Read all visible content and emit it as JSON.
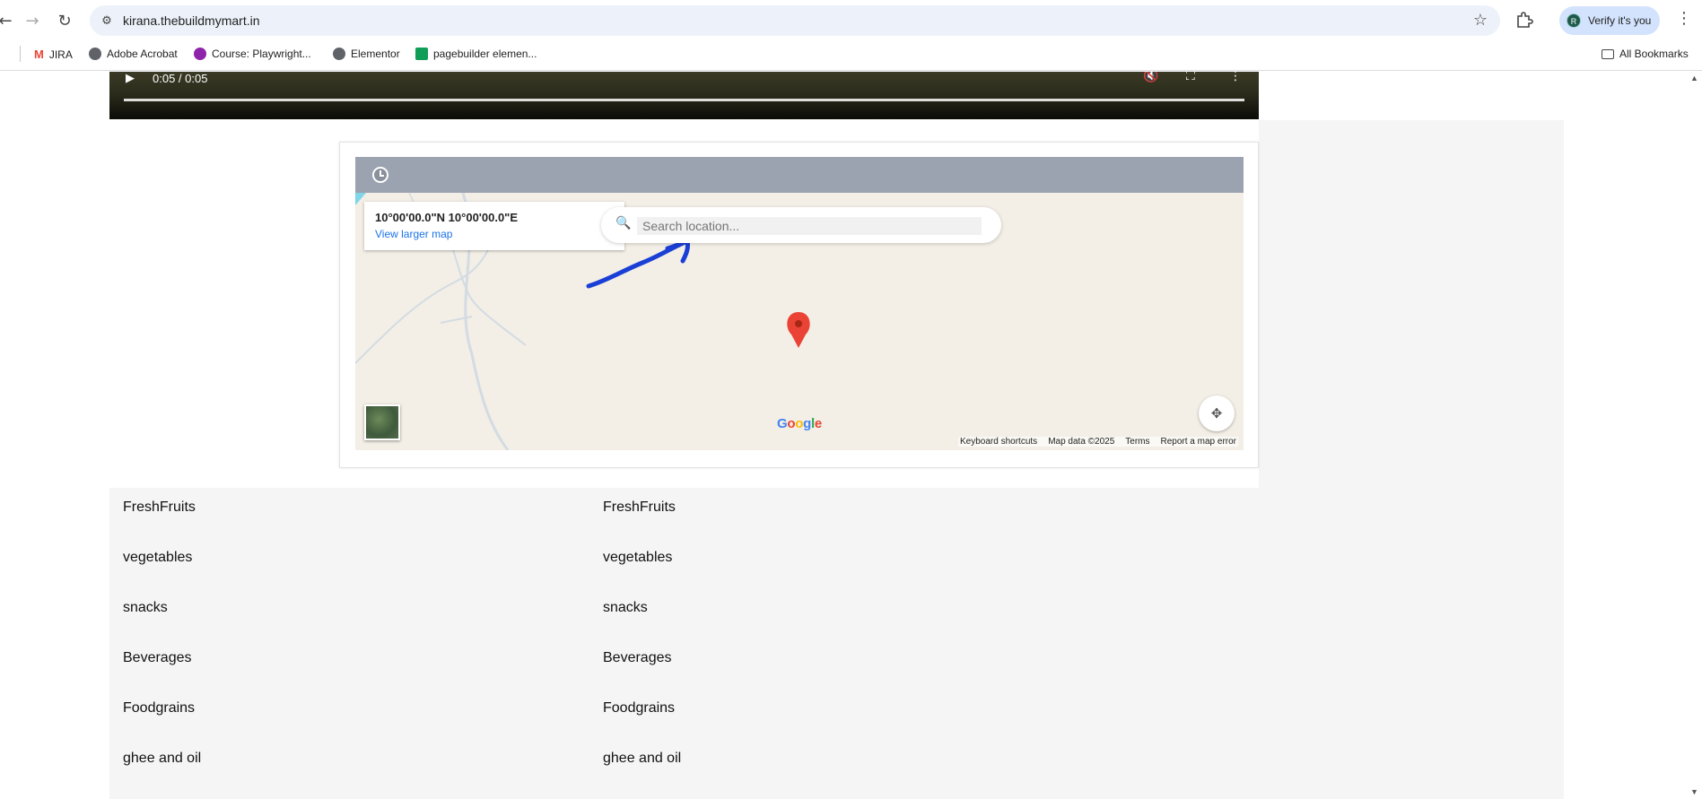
{
  "browser": {
    "url": "kirana.thebuildmymart.in",
    "verify_label": "Verify it's you",
    "avatar_letter": "R",
    "bookmarks": [
      {
        "label": "JIRA",
        "color": "#ea4335"
      },
      {
        "label": "Adobe Acrobat",
        "color": "#5f6368"
      },
      {
        "label": "Course: Playwright...",
        "color": "#8e24aa"
      },
      {
        "label": "Elementor",
        "color": "#5f6368"
      },
      {
        "label": "pagebuilder elemen...",
        "color": "#0f9d58"
      }
    ],
    "all_bookmarks": "All Bookmarks"
  },
  "video": {
    "time": "0:05 / 0:05",
    "progress": 1.0
  },
  "map": {
    "coordinates": "10°00'00.0\"N 10°00'00.0\"E",
    "larger_map_link": "View larger map",
    "search_placeholder": "Search location...",
    "logo": "Google",
    "footer": {
      "shortcuts": "Keyboard shortcuts",
      "map_data": "Map data ©2025",
      "terms": "Terms",
      "report": "Report a map error"
    }
  },
  "categories": {
    "left": [
      "FreshFruits",
      "vegetables",
      "snacks",
      "Beverages",
      "Foodgrains",
      "ghee and oil"
    ],
    "right": [
      "FreshFruits",
      "vegetables",
      "snacks",
      "Beverages",
      "Foodgrains",
      "ghee and oil"
    ]
  },
  "colors": {
    "annotation_arrow": "#1a3fd6",
    "map_header": "#9ca3b0",
    "pin": "#ea4335"
  }
}
